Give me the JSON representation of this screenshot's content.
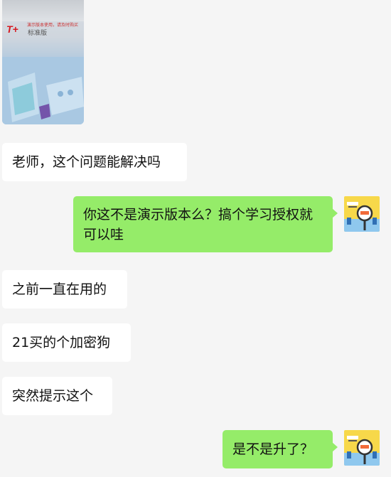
{
  "image_message": {
    "logo_text": "T+",
    "line1": "演示版本使用，请及时购买",
    "line2": "标准版"
  },
  "messages": [
    {
      "side": "left",
      "text": "老师，这个问题能解决吗"
    },
    {
      "side": "right",
      "text": "你这不是演示版本么？搞个学习授权就可以哇"
    },
    {
      "side": "left",
      "text": "之前一直在用的"
    },
    {
      "side": "left",
      "text": "21买的个加密狗"
    },
    {
      "side": "left",
      "text": "突然提示这个"
    },
    {
      "side": "right",
      "text": "是不是升了？"
    }
  ],
  "colors": {
    "background": "#f5f5f5",
    "incoming_bubble": "#ffffff",
    "outgoing_bubble": "#95ec69"
  },
  "avatar_icon": "magnifier-cartoon-avatar"
}
